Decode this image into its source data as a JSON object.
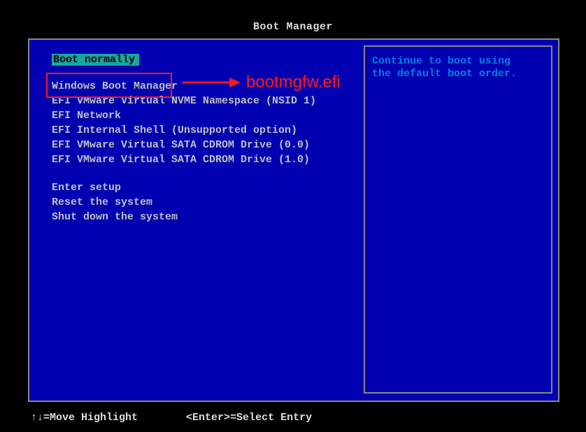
{
  "title": "Boot Manager",
  "selected": "Boot normally",
  "boot_items": [
    "Windows Boot Manager",
    "EFI VMware Virtual NVME Namespace (NSID 1)",
    "EFI Network",
    "EFI Internal Shell (Unsupported option)",
    "EFI VMware Virtual SATA CDROM Drive (0.0)",
    "EFI VMware Virtual SATA CDROM Drive (1.0)"
  ],
  "system_items": [
    "Enter setup",
    "Reset the system",
    "Shut down the system"
  ],
  "info": {
    "line1": "Continue to boot using",
    "line2": "the default boot order."
  },
  "footer": {
    "move": "↑↓=Move Highlight",
    "select": "<Enter>=Select Entry"
  },
  "annotation": {
    "label": "bootmgfw.efi"
  }
}
